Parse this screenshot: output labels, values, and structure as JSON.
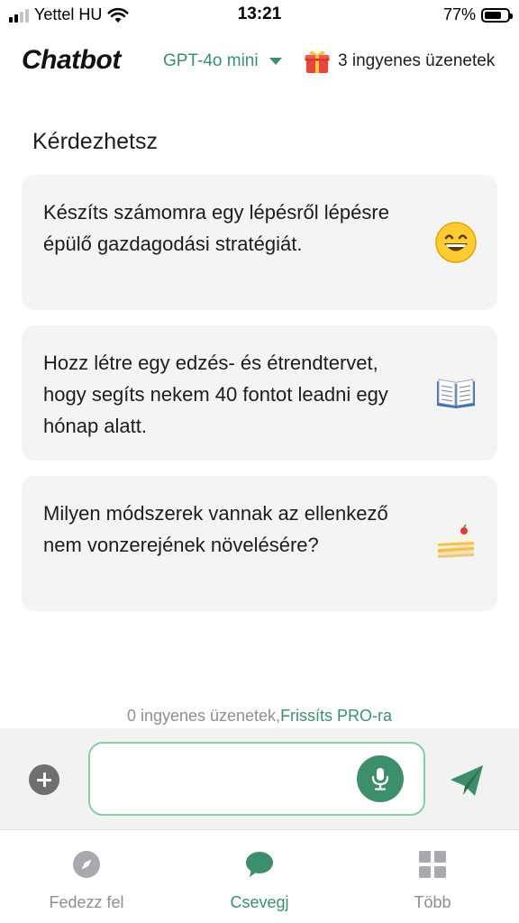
{
  "status_bar": {
    "carrier": "Yettel HU",
    "time": "13:21",
    "battery": "77%",
    "battery_level": 0.77
  },
  "header": {
    "logo": "Chatbot",
    "model": "GPT-4o mini",
    "free_messages": "3 ingyenes üzenetek",
    "gift_icon": "gift-icon"
  },
  "suggestions": {
    "title": "Kérdezhetsz",
    "items": [
      {
        "text": "Készíts számomra egy lépésről lépésre épülő gazdagodási stratégiát.",
        "icon": "grinning-face-emoji"
      },
      {
        "text": "Hozz létre egy edzés- és étrendtervet, hogy segíts nekem 40 fontot leadni egy hónap alatt.",
        "icon": "open-book-emoji"
      },
      {
        "text": "Milyen módszerek vannak az ellenkező nem vonzerejének növelésére?",
        "icon": "cake-slice-emoji"
      }
    ]
  },
  "composer": {
    "credits": "0 ingyenes üzenetek,",
    "upgrade": "Frissíts PRO-ra",
    "input_value": "",
    "input_placeholder": ""
  },
  "tabs": [
    {
      "label": "Fedezz fel",
      "icon": "compass-icon",
      "active": false
    },
    {
      "label": "Csevegj",
      "icon": "chat-bubble-icon",
      "active": true
    },
    {
      "label": "Több",
      "icon": "grid-icon",
      "active": false
    }
  ],
  "colors": {
    "accent": "#3d8f6b",
    "input_border": "#84cfa4",
    "card_bg": "#f4f4f4",
    "muted": "#8e8e93"
  }
}
